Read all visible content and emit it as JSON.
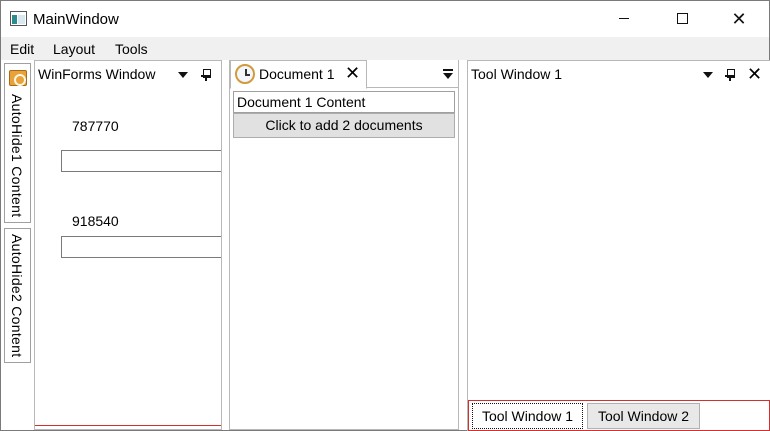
{
  "window": {
    "title": "MainWindow",
    "minimize_icon": "minimize-icon",
    "maximize_icon": "maximize-icon",
    "close_glyph": "✕"
  },
  "menu": {
    "items": [
      {
        "label": "Edit"
      },
      {
        "label": "Layout"
      },
      {
        "label": "Tools"
      }
    ]
  },
  "autohide": {
    "tabs": [
      {
        "label": "AutoHide1 Content",
        "icon": "autohide-icon"
      },
      {
        "label": "AutoHide2 Content"
      }
    ]
  },
  "winforms": {
    "title": "WinForms Window",
    "fields": [
      {
        "label": "787770",
        "value": ""
      },
      {
        "label": "918540",
        "value": ""
      }
    ]
  },
  "document": {
    "tab_label": "Document 1",
    "close_glyph": "✕",
    "content_label": "Document 1 Content",
    "add_button_label": "Click to add 2 documents"
  },
  "tool_window": {
    "title": "Tool Window 1",
    "close_glyph": "✕",
    "tabs": [
      {
        "label": "Tool Window 1",
        "selected": true
      },
      {
        "label": "Tool Window 2",
        "selected": false
      }
    ]
  },
  "colors": {
    "accent_red": "#d32f2f",
    "menu_background": "#f0f0f0",
    "button_background": "#e1e1e1"
  }
}
